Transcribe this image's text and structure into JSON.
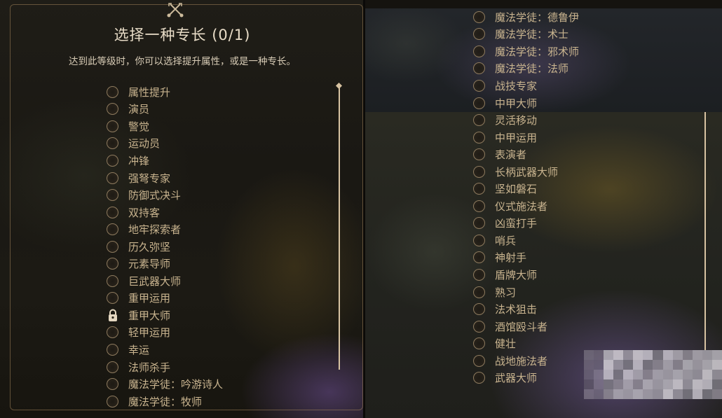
{
  "panel": {
    "title": "选择一种专长 (0/1)",
    "subtitle": "达到此等级时，你可以选择提升属性，或是一种专长。"
  },
  "left_options": [
    {
      "label": "属性提升",
      "locked": false
    },
    {
      "label": "演员",
      "locked": false
    },
    {
      "label": "警觉",
      "locked": false
    },
    {
      "label": "运动员",
      "locked": false
    },
    {
      "label": "冲锋",
      "locked": false
    },
    {
      "label": "强弩专家",
      "locked": false
    },
    {
      "label": "防御式决斗",
      "locked": false
    },
    {
      "label": "双持客",
      "locked": false
    },
    {
      "label": "地牢探索者",
      "locked": false
    },
    {
      "label": "历久弥坚",
      "locked": false
    },
    {
      "label": "元素导师",
      "locked": false
    },
    {
      "label": "巨武器大师",
      "locked": false
    },
    {
      "label": "重甲运用",
      "locked": false
    },
    {
      "label": "重甲大师",
      "locked": true
    },
    {
      "label": "轻甲运用",
      "locked": false
    },
    {
      "label": "幸运",
      "locked": false
    },
    {
      "label": "法师杀手",
      "locked": false
    },
    {
      "label": "魔法学徒：吟游诗人",
      "locked": false
    },
    {
      "label": "魔法学徒：牧师",
      "locked": false
    }
  ],
  "right_options": [
    {
      "label": "魔法学徒：德鲁伊",
      "locked": false
    },
    {
      "label": "魔法学徒：术士",
      "locked": false
    },
    {
      "label": "魔法学徒：邪术师",
      "locked": false
    },
    {
      "label": "魔法学徒：法师",
      "locked": false
    },
    {
      "label": "战技专家",
      "locked": false
    },
    {
      "label": "中甲大师",
      "locked": false
    },
    {
      "label": "灵活移动",
      "locked": false
    },
    {
      "label": "中甲运用",
      "locked": false
    },
    {
      "label": "表演者",
      "locked": false
    },
    {
      "label": "长柄武器大师",
      "locked": false
    },
    {
      "label": "坚如磐石",
      "locked": false
    },
    {
      "label": "仪式施法者",
      "locked": false
    },
    {
      "label": "凶蛮打手",
      "locked": false
    },
    {
      "label": "哨兵",
      "locked": false
    },
    {
      "label": "神射手",
      "locked": false
    },
    {
      "label": "盾牌大师",
      "locked": false
    },
    {
      "label": "熟习",
      "locked": false
    },
    {
      "label": "法术狙击",
      "locked": false
    },
    {
      "label": "酒馆殴斗者",
      "locked": false
    },
    {
      "label": "健壮",
      "locked": false
    },
    {
      "label": "战地施法者",
      "locked": false
    },
    {
      "label": "武器大师",
      "locked": false
    }
  ],
  "icons": {
    "crest": "crossed-keys-icon",
    "radio": "radio-empty-icon",
    "lock": "padlock-icon"
  },
  "colors": {
    "option_text": "#c9b48f",
    "title_text": "#e8dcc7",
    "radio_border": "#8d7a5e",
    "scrollbar": "#d8c3a2"
  }
}
